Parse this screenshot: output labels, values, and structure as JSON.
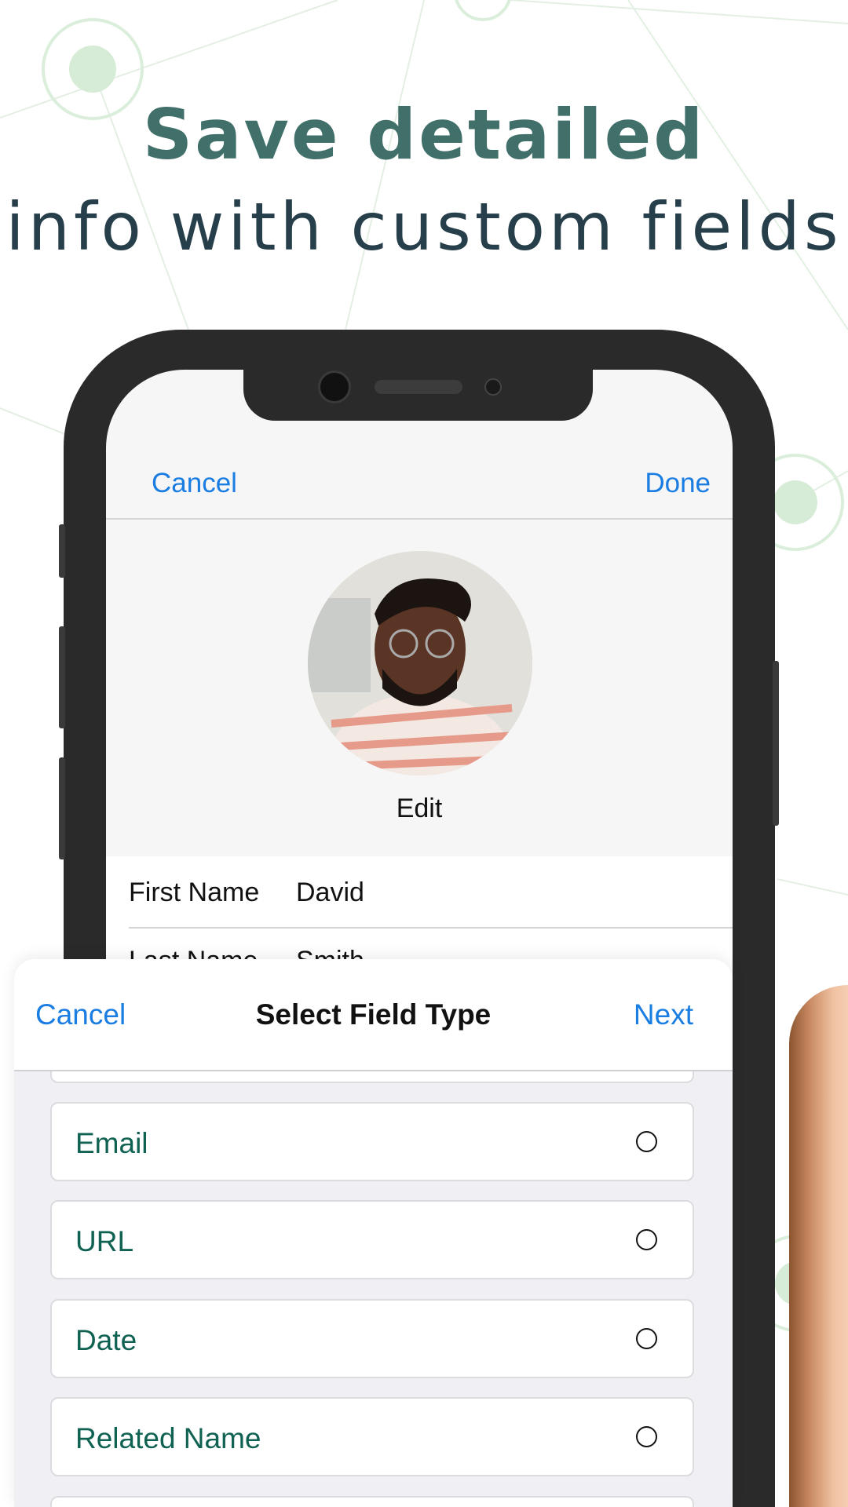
{
  "headline": {
    "line1": "Save detailed",
    "line2": "info with custom fields"
  },
  "contact_editor": {
    "cancel_label": "Cancel",
    "done_label": "Done",
    "photo_edit_label": "Edit",
    "fields": [
      {
        "label": "First Name",
        "value": "David"
      },
      {
        "label": "Last Name",
        "value": "Smith"
      }
    ]
  },
  "field_type_sheet": {
    "title": "Select Field Type",
    "cancel_label": "Cancel",
    "next_label": "Next",
    "options": [
      {
        "label": "Email",
        "selected": false
      },
      {
        "label": "URL",
        "selected": false
      },
      {
        "label": "Date",
        "selected": false
      },
      {
        "label": "Related Name",
        "selected": false
      }
    ]
  },
  "colors": {
    "accent": "#1a7de2",
    "headline_green": "#41706a",
    "headline_dark": "#263f4a",
    "option_text": "#0f6152"
  }
}
